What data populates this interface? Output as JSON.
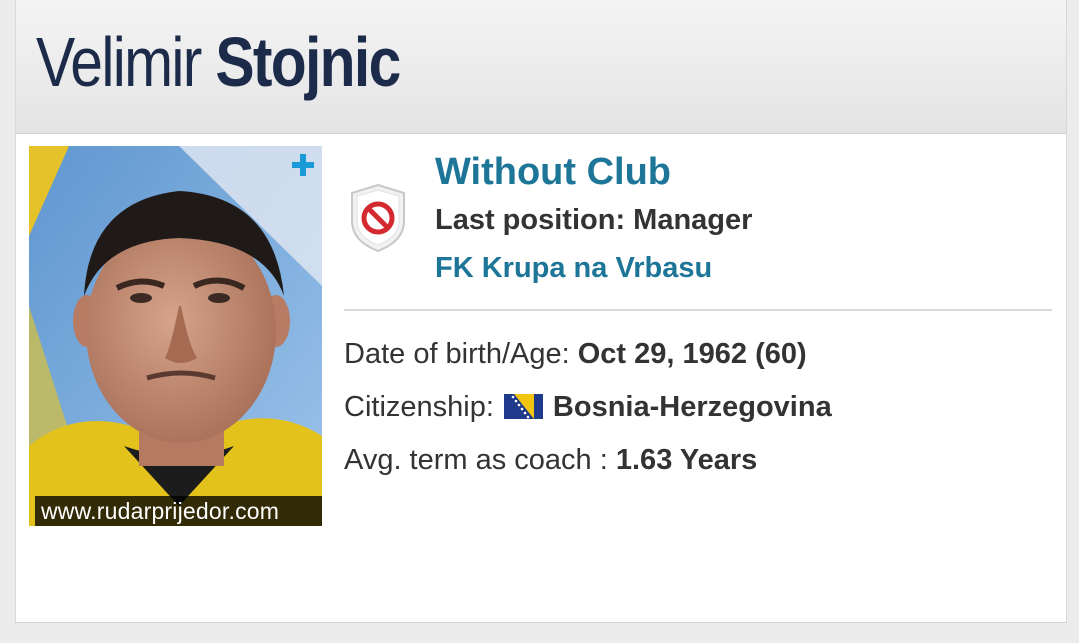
{
  "profile": {
    "first_name": "Velimir",
    "last_name": "Stojnic",
    "photo_credit": "www.rudarprijedor.com"
  },
  "club": {
    "status": "Without Club",
    "last_position": "Last position: Manager",
    "last_club": "FK Krupa na Vrbasu",
    "logo_icon": "no-club-shield-icon"
  },
  "details": {
    "dob_label": "Date of birth/Age: ",
    "dob_value": "Oct 29, 1962 (60)",
    "citizenship_label": "Citizenship:",
    "citizenship_value": "Bosnia-Herzegovina",
    "citizenship_flag": "bosnia-herzegovina-flag-icon",
    "avg_term_label": "Avg. term as coach : ",
    "avg_term_value": "1.63 Years"
  },
  "colors": {
    "name": "#1d2b4a",
    "link": "#1d7598",
    "text": "#333333",
    "plus": "#1a9bd7"
  }
}
